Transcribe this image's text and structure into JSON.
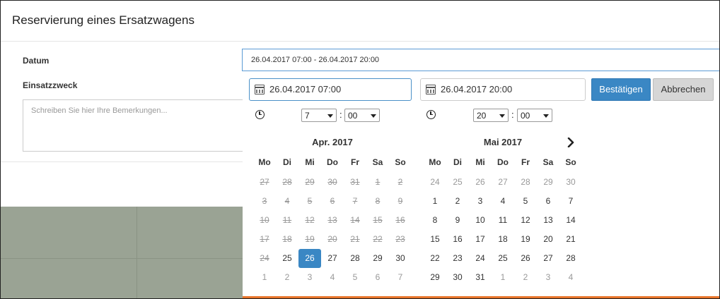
{
  "modal": {
    "title": "Reservierung eines Ersatzwagens",
    "datum_label": "Datum",
    "einsatzzweck_label": "Einsatzzweck",
    "remarks_placeholder": "Schreiben Sie hier Ihre Bemerkungen..."
  },
  "date_field": {
    "value": "26.04.2017 07:00 - 26.04.2017 20:00"
  },
  "picker": {
    "start_value": "26.04.2017 07:00",
    "end_value": "26.04.2017 20:00",
    "confirm_label": "Bestätigen",
    "cancel_label": "Abbrechen",
    "start_time": {
      "hour": "7",
      "minute": "00",
      "separator": ":"
    },
    "end_time": {
      "hour": "20",
      "minute": "00",
      "separator": ":"
    },
    "icons": {
      "calendar": "calendar-icon",
      "clock": "clock-icon",
      "next": "chevron-right-icon"
    },
    "colors": {
      "accent": "#3a87c4",
      "orange_bar": "#e8742a"
    },
    "weekdays": [
      "Mo",
      "Di",
      "Mi",
      "Do",
      "Fr",
      "Sa",
      "So"
    ],
    "calendars": [
      {
        "month_label": "Apr. 2017",
        "days": [
          {
            "t": "27",
            "s": "past"
          },
          {
            "t": "28",
            "s": "past"
          },
          {
            "t": "29",
            "s": "past"
          },
          {
            "t": "30",
            "s": "past"
          },
          {
            "t": "31",
            "s": "past"
          },
          {
            "t": "1",
            "s": "past"
          },
          {
            "t": "2",
            "s": "past"
          },
          {
            "t": "3",
            "s": "past"
          },
          {
            "t": "4",
            "s": "past"
          },
          {
            "t": "5",
            "s": "past"
          },
          {
            "t": "6",
            "s": "past"
          },
          {
            "t": "7",
            "s": "past"
          },
          {
            "t": "8",
            "s": "past"
          },
          {
            "t": "9",
            "s": "past"
          },
          {
            "t": "10",
            "s": "past"
          },
          {
            "t": "11",
            "s": "past"
          },
          {
            "t": "12",
            "s": "past"
          },
          {
            "t": "13",
            "s": "past"
          },
          {
            "t": "14",
            "s": "past"
          },
          {
            "t": "15",
            "s": "past"
          },
          {
            "t": "16",
            "s": "past"
          },
          {
            "t": "17",
            "s": "past"
          },
          {
            "t": "18",
            "s": "past"
          },
          {
            "t": "19",
            "s": "past"
          },
          {
            "t": "20",
            "s": "past"
          },
          {
            "t": "21",
            "s": "past"
          },
          {
            "t": "22",
            "s": "past"
          },
          {
            "t": "23",
            "s": "past"
          },
          {
            "t": "24",
            "s": "past"
          },
          {
            "t": "25",
            "s": "normal"
          },
          {
            "t": "26",
            "s": "selected"
          },
          {
            "t": "27",
            "s": "normal"
          },
          {
            "t": "28",
            "s": "normal"
          },
          {
            "t": "29",
            "s": "normal"
          },
          {
            "t": "30",
            "s": "normal"
          },
          {
            "t": "1",
            "s": "other"
          },
          {
            "t": "2",
            "s": "other"
          },
          {
            "t": "3",
            "s": "other"
          },
          {
            "t": "4",
            "s": "other"
          },
          {
            "t": "5",
            "s": "other"
          },
          {
            "t": "6",
            "s": "other"
          },
          {
            "t": "7",
            "s": "other"
          }
        ]
      },
      {
        "month_label": "Mai 2017",
        "days": [
          {
            "t": "24",
            "s": "other"
          },
          {
            "t": "25",
            "s": "other"
          },
          {
            "t": "26",
            "s": "other"
          },
          {
            "t": "27",
            "s": "other"
          },
          {
            "t": "28",
            "s": "other"
          },
          {
            "t": "29",
            "s": "other"
          },
          {
            "t": "30",
            "s": "other"
          },
          {
            "t": "1",
            "s": "normal"
          },
          {
            "t": "2",
            "s": "normal"
          },
          {
            "t": "3",
            "s": "normal"
          },
          {
            "t": "4",
            "s": "normal"
          },
          {
            "t": "5",
            "s": "normal"
          },
          {
            "t": "6",
            "s": "normal"
          },
          {
            "t": "7",
            "s": "normal"
          },
          {
            "t": "8",
            "s": "normal"
          },
          {
            "t": "9",
            "s": "normal"
          },
          {
            "t": "10",
            "s": "normal"
          },
          {
            "t": "11",
            "s": "normal"
          },
          {
            "t": "12",
            "s": "normal"
          },
          {
            "t": "13",
            "s": "normal"
          },
          {
            "t": "14",
            "s": "normal"
          },
          {
            "t": "15",
            "s": "normal"
          },
          {
            "t": "16",
            "s": "normal"
          },
          {
            "t": "17",
            "s": "normal"
          },
          {
            "t": "18",
            "s": "normal"
          },
          {
            "t": "19",
            "s": "normal"
          },
          {
            "t": "20",
            "s": "normal"
          },
          {
            "t": "21",
            "s": "normal"
          },
          {
            "t": "22",
            "s": "normal"
          },
          {
            "t": "23",
            "s": "normal"
          },
          {
            "t": "24",
            "s": "normal"
          },
          {
            "t": "25",
            "s": "normal"
          },
          {
            "t": "26",
            "s": "normal"
          },
          {
            "t": "27",
            "s": "normal"
          },
          {
            "t": "28",
            "s": "normal"
          },
          {
            "t": "29",
            "s": "normal"
          },
          {
            "t": "30",
            "s": "normal"
          },
          {
            "t": "31",
            "s": "normal"
          },
          {
            "t": "1",
            "s": "other"
          },
          {
            "t": "2",
            "s": "other"
          },
          {
            "t": "3",
            "s": "other"
          },
          {
            "t": "4",
            "s": "other"
          }
        ]
      }
    ]
  }
}
